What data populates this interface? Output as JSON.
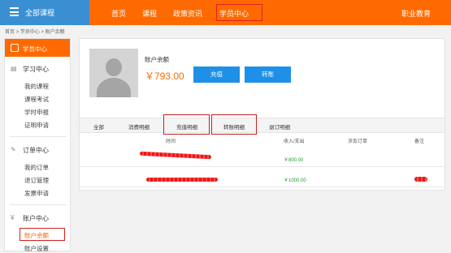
{
  "topbar": {
    "all_courses": "全部课程",
    "nav": [
      "首页",
      "课程",
      "政策资讯",
      "学员中心"
    ],
    "right": "职业教育",
    "colors": {
      "bar": "#ff6a00",
      "all_courses": "#3a8fd3"
    }
  },
  "breadcrumb": "首页 > 学员中心 > 账户余额",
  "sidebar": {
    "header": "学员中心",
    "sections": [
      {
        "title": "学习中心",
        "icon": "book-icon",
        "items": [
          "我的课程",
          "课程考试",
          "学时申报",
          "证明申请"
        ]
      },
      {
        "title": "订单中心",
        "icon": "edit-icon",
        "items": [
          "我的订单",
          "退订管理",
          "发票申请"
        ]
      },
      {
        "title": "账户中心",
        "icon": "currency-icon",
        "items": [
          "账户余额",
          "账户设置"
        ]
      }
    ]
  },
  "account": {
    "balance_label": "账户余额",
    "balance": "￥793.00",
    "recharge_label": "充值",
    "transfer_label": "转账"
  },
  "tabs": [
    "全部",
    "消费明细",
    "充值明细",
    "转账明细",
    "退订明细"
  ],
  "table": {
    "headers": [
      "时间",
      "收入/支出",
      "涉及订单",
      "备注"
    ],
    "rows": [
      {
        "amount": "￥800.00"
      },
      {
        "amount": "￥1000.00"
      }
    ]
  }
}
